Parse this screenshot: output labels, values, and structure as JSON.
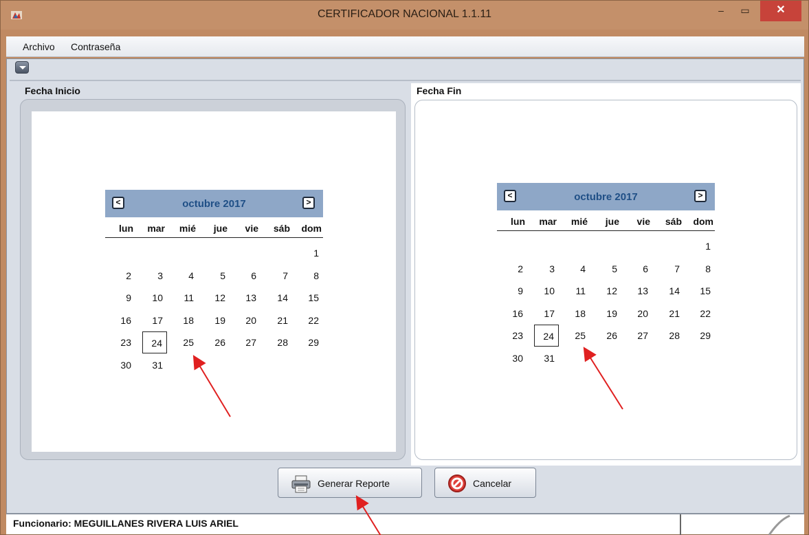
{
  "window": {
    "title": "CERTIFICADOR NACIONAL 1.1.11",
    "minimize_icon": "minimize-icon",
    "maximize_icon": "maximize-icon",
    "close_icon": "close-icon",
    "min_glyph": "–",
    "max_glyph": "▭",
    "close_glyph": "✕"
  },
  "menu": {
    "items": [
      "Archivo",
      "Contraseña"
    ]
  },
  "panels": {
    "left_title": "Fecha Inicio",
    "right_title": "Fecha Fin"
  },
  "calendar_start": {
    "month_label": "octubre 2017",
    "prev": "<",
    "next": ">",
    "days_of_week": [
      "lun",
      "mar",
      "mié",
      "jue",
      "vie",
      "sáb",
      "dom"
    ],
    "selected_day": 24,
    "first_weekday_index": 6,
    "days_in_month": 31
  },
  "calendar_end": {
    "month_label": "octubre 2017",
    "prev": "<",
    "next": ">",
    "days_of_week": [
      "lun",
      "mar",
      "mié",
      "jue",
      "vie",
      "sáb",
      "dom"
    ],
    "selected_day": 24,
    "first_weekday_index": 6,
    "days_in_month": 31
  },
  "buttons": {
    "generate_label": "Generar Reporte",
    "cancel_label": "Cancelar"
  },
  "status": {
    "text": "Funcionario: MEGUILLANES RIVERA LUIS ARIEL"
  },
  "colors": {
    "annotation_arrow": "#e02020",
    "calendar_header": "#8ea7c7",
    "month_text": "#1f4f86"
  }
}
